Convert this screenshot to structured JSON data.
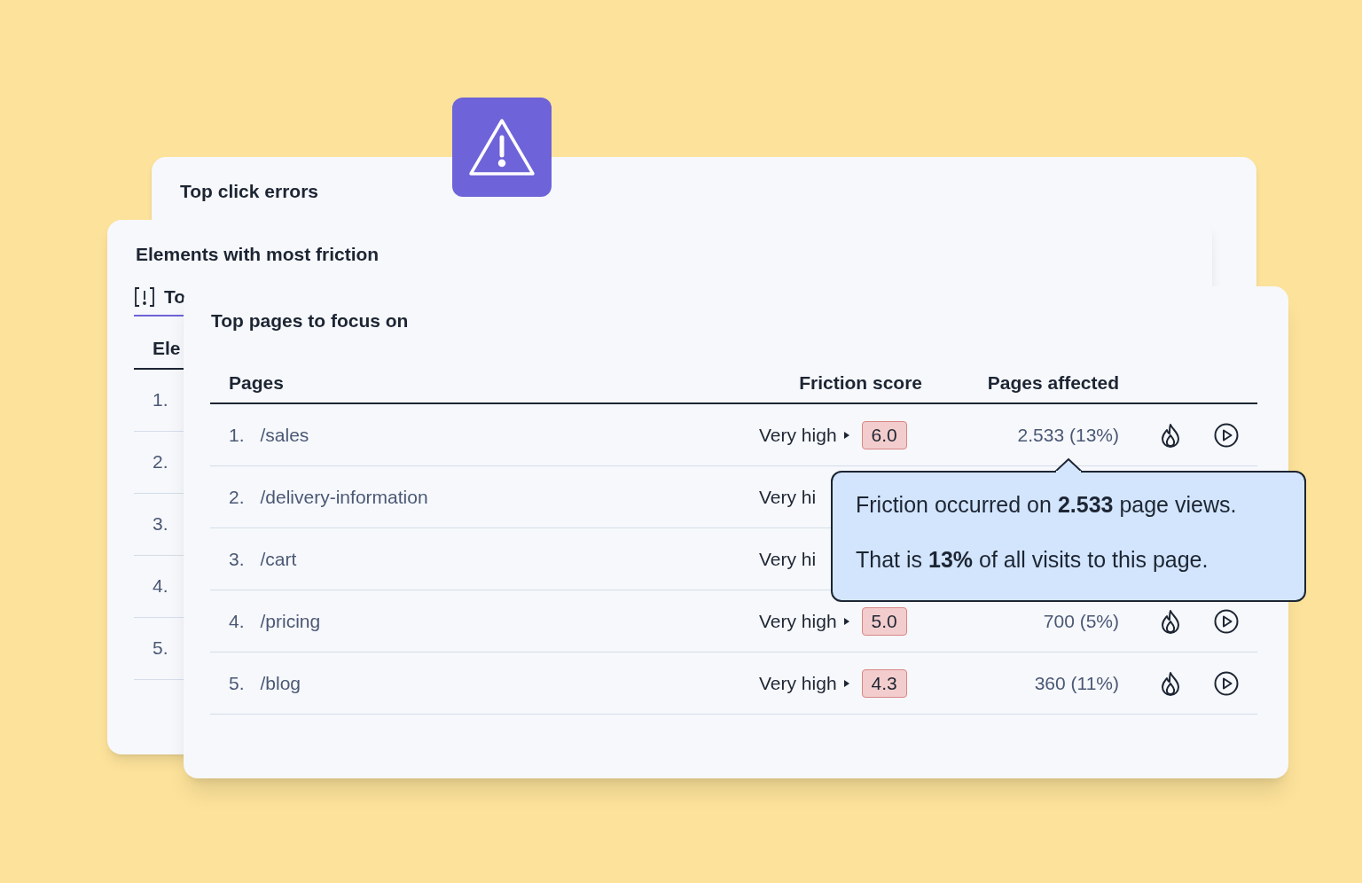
{
  "back_card": {
    "title": "Top click errors"
  },
  "middle_card": {
    "title": "Elements with most friction",
    "tabs": [
      {
        "label": "To",
        "selected": true
      }
    ],
    "column": "Ele",
    "rows": [
      "1.",
      "2.",
      "3.",
      "4.",
      "5."
    ]
  },
  "front_card": {
    "title": "Top pages to focus on",
    "columns": [
      "Pages",
      "Friction score",
      "Pages affected"
    ],
    "rows": [
      {
        "rank": "1.",
        "page": "/sales",
        "friction_label": "Very high",
        "score": "6.0",
        "affected": "2.533 (13%)"
      },
      {
        "rank": "2.",
        "page": "/delivery-information",
        "friction_label": "Very hi"
      },
      {
        "rank": "3.",
        "page": "/cart",
        "friction_label": "Very hi"
      },
      {
        "rank": "4.",
        "page": "/pricing",
        "friction_label": "Very high",
        "score": "5.0",
        "affected": "700 (5%)"
      },
      {
        "rank": "5.",
        "page": "/blog",
        "friction_label": "Very high",
        "score": "4.3",
        "affected": "360 (11%)"
      }
    ]
  },
  "tooltip": {
    "lines": [
      "Friction occurred on **2.533** page views.",
      "That is **13%** of all visits to this page."
    ]
  }
}
